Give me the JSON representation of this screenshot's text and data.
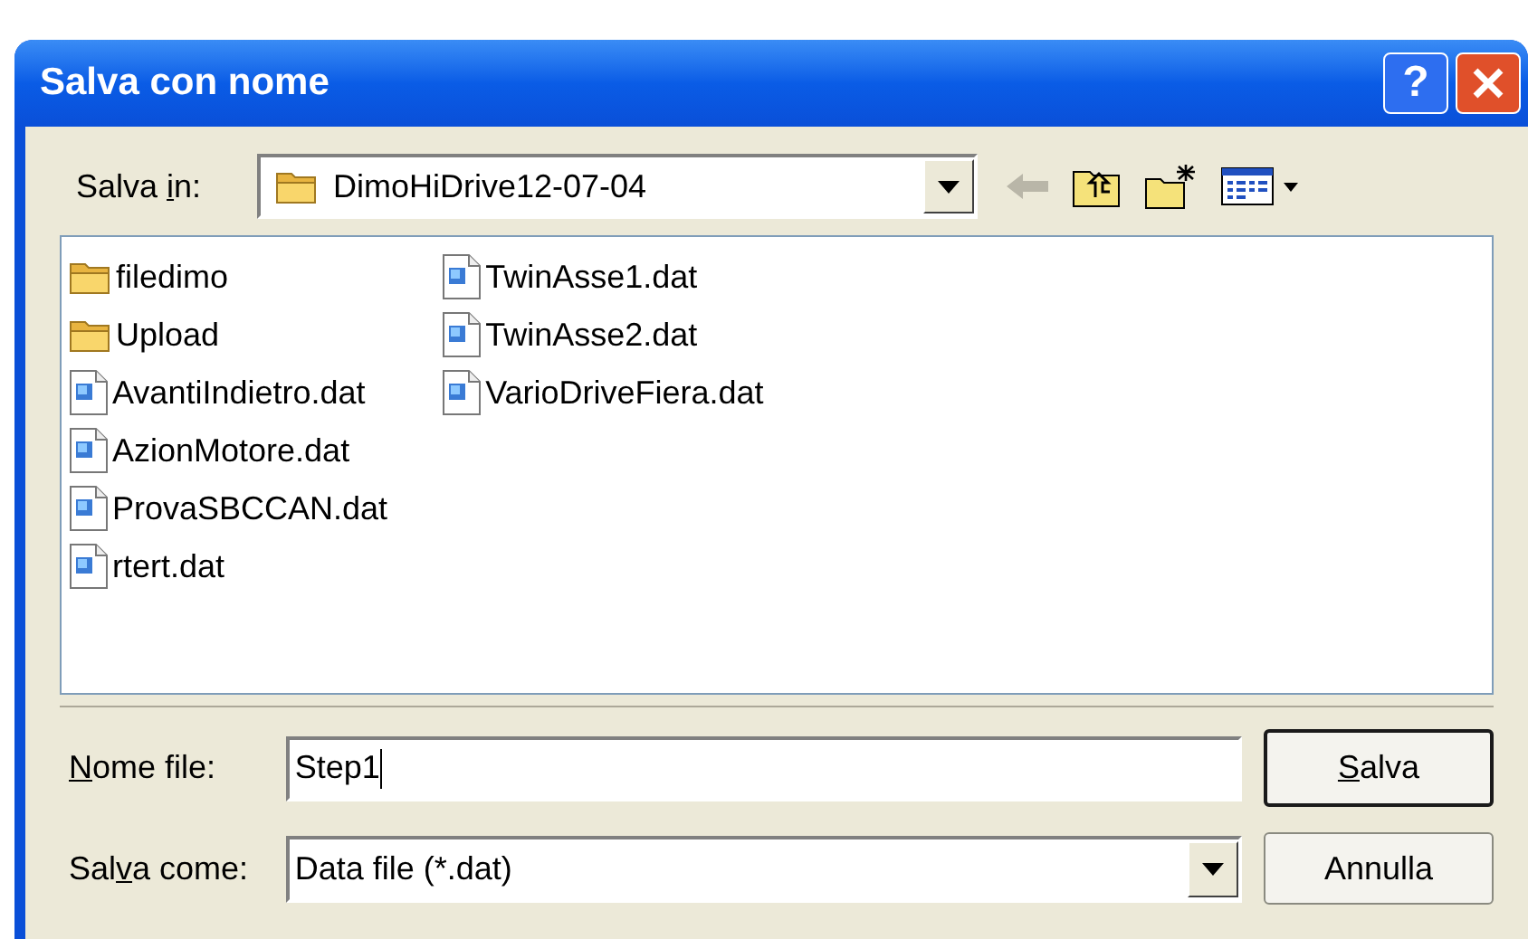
{
  "window": {
    "title": "Salva con nome"
  },
  "title_bar_buttons": [
    {
      "kind": "help",
      "label": "?"
    },
    {
      "kind": "close"
    }
  ],
  "save_in": {
    "label": {
      "before": "Salva ",
      "key": "i",
      "after": "n:"
    },
    "value": "DimoHiDrive12-07-04"
  },
  "toolbar": [
    {
      "kind": "back",
      "disabled": true
    },
    {
      "kind": "up",
      "disabled": false
    },
    {
      "kind": "new_folder",
      "disabled": false
    },
    {
      "kind": "view_menu",
      "disabled": false
    }
  ],
  "files": [
    {
      "name": "filedimo",
      "kind": "folder"
    },
    {
      "name": "Upload",
      "kind": "folder"
    },
    {
      "name": "AvantiIndietro.dat",
      "kind": "file"
    },
    {
      "name": "AzionMotore.dat",
      "kind": "file"
    },
    {
      "name": "ProvaSBCCAN.dat",
      "kind": "file"
    },
    {
      "name": "rtert.dat",
      "kind": "file"
    },
    {
      "name": "TwinAsse1.dat",
      "kind": "file"
    },
    {
      "name": "TwinAsse2.dat",
      "kind": "file"
    },
    {
      "name": "VarioDriveFiera.dat",
      "kind": "file"
    }
  ],
  "file_name": {
    "label": {
      "key": "N",
      "after": "ome file:"
    },
    "value": "Step1",
    "focused": true
  },
  "save_as_type": {
    "label": {
      "before": "Sal",
      "key": "v",
      "after": "a come:"
    },
    "value": "Data file (*.dat)"
  },
  "buttons": [
    {
      "label": {
        "key": "S",
        "after": "alva"
      },
      "default": true
    },
    {
      "label": {
        "before": "Annulla"
      },
      "default": false
    }
  ]
}
